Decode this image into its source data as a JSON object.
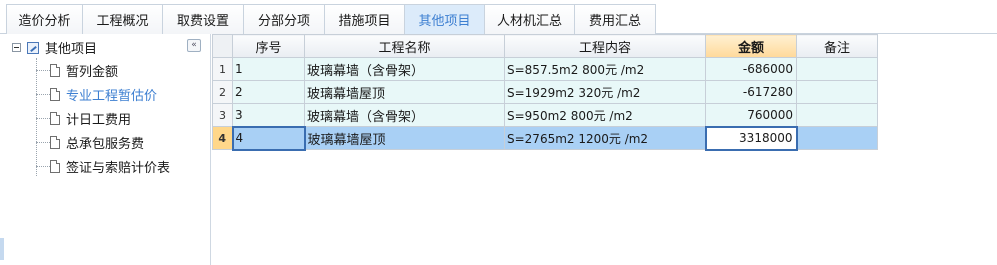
{
  "tabs": [
    {
      "label": "造价分析",
      "active": false
    },
    {
      "label": "工程概况",
      "active": false
    },
    {
      "label": "取费设置",
      "active": false
    },
    {
      "label": "分部分项",
      "active": false
    },
    {
      "label": "措施项目",
      "active": false
    },
    {
      "label": "其他项目",
      "active": true
    },
    {
      "label": "人材机汇总",
      "active": false
    },
    {
      "label": "费用汇总",
      "active": false
    }
  ],
  "sidebar": {
    "collapse_glyph": "«",
    "root_label": "其他项目",
    "items": [
      {
        "label": "暂列金额",
        "selected": false
      },
      {
        "label": "专业工程暂估价",
        "selected": true
      },
      {
        "label": "计日工费用",
        "selected": false
      },
      {
        "label": "总承包服务费",
        "selected": false
      },
      {
        "label": "签证与索赔计价表",
        "selected": false
      }
    ]
  },
  "grid": {
    "headers": {
      "seq": "序号",
      "name": "工程名称",
      "content": "工程内容",
      "amount": "金额",
      "remark": "备注"
    },
    "rows": [
      {
        "row_num": "1",
        "seq": "1",
        "name": "玻璃幕墙（含骨架）",
        "content": "S=857.5m2  800元 /m2",
        "amount": "-686000",
        "remark": ""
      },
      {
        "row_num": "2",
        "seq": "2",
        "name": "玻璃幕墙屋顶",
        "content": "S=1929m2  320元 /m2",
        "amount": "-617280",
        "remark": ""
      },
      {
        "row_num": "3",
        "seq": "3",
        "name": "玻璃幕墙（含骨架）",
        "content": "S=950m2  800元 /m2",
        "amount": "760000",
        "remark": ""
      },
      {
        "row_num": "4",
        "seq": "4",
        "name": "玻璃幕墙屋顶",
        "content": "S=2765m2  1200元 /m2",
        "amount": "3318000",
        "remark": ""
      }
    ],
    "selected_row": 4
  },
  "colors": {
    "active_tab_bg": "#dcebfa",
    "active_tab_text": "#3d7fd1",
    "row_bg": "#e8f8f8",
    "selected_row_bg": "#a9d0f5",
    "amount_header_bg": "#ffd99a"
  }
}
